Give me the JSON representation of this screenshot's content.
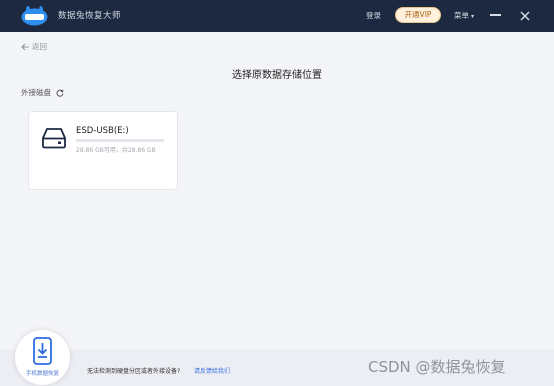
{
  "app": {
    "title": "数据兔恢复大师",
    "logo_text": "数据兔"
  },
  "header": {
    "login_label": "登录",
    "vip_label": "开通VIP",
    "menu_label": "菜单",
    "menu_caret": "▾"
  },
  "nav": {
    "back_label": "返回"
  },
  "page": {
    "title": "选择原数据存储位置"
  },
  "section": {
    "external_label": "外接磁盘"
  },
  "drives": [
    {
      "name": "ESD-USB(E:)",
      "size_text": "28.86 GB可用，共28.86 GB",
      "used_fraction": 0.0
    }
  ],
  "footer": {
    "phone_button_label": "手机数据恢复",
    "notice_text": "无法检测到硬盘分区或者外接设备?",
    "notice_link": "请反馈给我们"
  },
  "watermark": "CSDN @数据兔恢复",
  "colors": {
    "titlebar": "#1c2940",
    "vip_bg": "#fff1db",
    "link": "#3a70e0",
    "accent": "#2f6be0"
  }
}
